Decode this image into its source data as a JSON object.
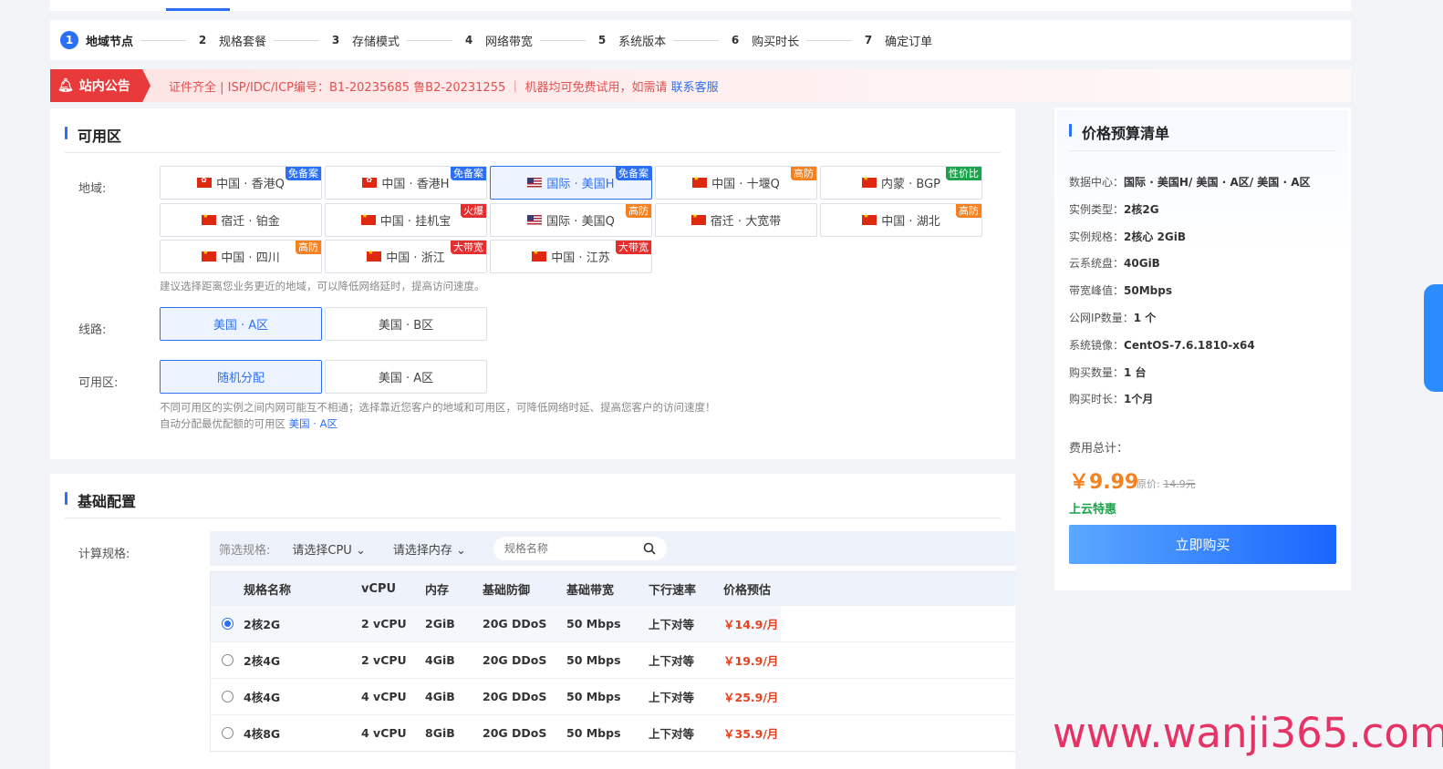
{
  "steps": [
    {
      "num": "1",
      "label": "地域节点"
    },
    {
      "num": "2",
      "label": "规格套餐"
    },
    {
      "num": "3",
      "label": "存储模式"
    },
    {
      "num": "4",
      "label": "网络带宽"
    },
    {
      "num": "5",
      "label": "系统版本"
    },
    {
      "num": "6",
      "label": "购买时长"
    },
    {
      "num": "7",
      "label": "确定订单"
    }
  ],
  "notice": {
    "tag": "站内公告",
    "text": "证件齐全 | ISP/IDC/ICP编号：B1-20235685 鲁B2-20231255 ｜ 机器均可免费试用，如需请 ",
    "link": "联系客服"
  },
  "availability": {
    "title": "可用区",
    "region_label": "地域:",
    "regions": [
      {
        "name": "中国 · 香港Q",
        "flag": "hk",
        "badge": "免备案",
        "badge_color": "blue"
      },
      {
        "name": "中国 · 香港H",
        "flag": "hk",
        "badge": "免备案",
        "badge_color": "blue"
      },
      {
        "name": "国际 · 美国H",
        "flag": "us",
        "badge": "免备案",
        "badge_color": "blue",
        "selected": true
      },
      {
        "name": "中国 · 十堰Q",
        "flag": "cn",
        "badge": "高防",
        "badge_color": "orange"
      },
      {
        "name": "内蒙 · BGP",
        "flag": "cn",
        "badge": "性价比",
        "badge_color": "green"
      },
      {
        "name": "宿迁 · 铂金",
        "flag": "cn",
        "badge": "",
        "badge_color": ""
      },
      {
        "name": "中国 · 挂机宝",
        "flag": "cn",
        "badge": "火爆",
        "badge_color": "red"
      },
      {
        "name": "国际 · 美国Q",
        "flag": "us",
        "badge": "高防",
        "badge_color": "orange"
      },
      {
        "name": "宿迁 · 大宽带",
        "flag": "cn",
        "badge": "",
        "badge_color": ""
      },
      {
        "name": "中国 · 湖北",
        "flag": "cn",
        "badge": "高防",
        "badge_color": "orange"
      },
      {
        "name": "中国 · 四川",
        "flag": "cn",
        "badge": "高防",
        "badge_color": "orange"
      },
      {
        "name": "中国 · 浙江",
        "flag": "cn",
        "badge": "大带宽",
        "badge_color": "red"
      },
      {
        "name": "中国 · 江苏",
        "flag": "cn",
        "badge": "大带宽",
        "badge_color": "red"
      }
    ],
    "region_hint": "建议选择距离您业务更近的地域，可以降低网络延时，提高访问速度。",
    "line_label": "线路:",
    "lines": [
      {
        "name": "美国 · A区",
        "selected": true
      },
      {
        "name": "美国 · B区",
        "selected": false
      }
    ],
    "zone_label": "可用区:",
    "zones": [
      {
        "name": "随机分配",
        "selected": true
      },
      {
        "name": "美国 · A区",
        "selected": false
      }
    ],
    "zone_hint": "不同可用区的实例之间内网可能互不相通；选择靠近您客户的地域和可用区，可降低网络时延、提高您客户的访问速度！",
    "zone_hint2": "自动分配最优配额的可用区 ",
    "zone_hint2_link": "美国 · A区"
  },
  "base": {
    "title": "基础配置",
    "compute_label": "计算规格:",
    "filter_label": "筛选规格:",
    "cpu_select": "请选择CPU ⌄",
    "mem_select": "请选择内存 ⌄",
    "search_placeholder": "规格名称",
    "columns": [
      "规格名称",
      "vCPU",
      "内存",
      "基础防御",
      "基础带宽",
      "下行速率",
      "价格预估"
    ],
    "rows": [
      {
        "name": "2核2G",
        "vcpu": "2 vCPU",
        "mem": "2GiB",
        "ddos": "20G DDoS",
        "bw": "50 Mbps",
        "speed": "上下对等",
        "price": "￥14.9/月",
        "selected": true
      },
      {
        "name": "2核4G",
        "vcpu": "2 vCPU",
        "mem": "4GiB",
        "ddos": "20G DDoS",
        "bw": "50 Mbps",
        "speed": "上下对等",
        "price": "￥19.9/月",
        "selected": false
      },
      {
        "name": "4核4G",
        "vcpu": "4 vCPU",
        "mem": "4GiB",
        "ddos": "20G DDoS",
        "bw": "50 Mbps",
        "speed": "上下对等",
        "price": "￥25.9/月",
        "selected": false
      },
      {
        "name": "4核8G",
        "vcpu": "4 vCPU",
        "mem": "8GiB",
        "ddos": "20G DDoS",
        "bw": "50 Mbps",
        "speed": "上下对等",
        "price": "￥35.9/月",
        "selected": false
      }
    ]
  },
  "summary": {
    "title": "价格预算清单",
    "items": [
      {
        "label": "数据中心：",
        "value": "国际 · 美国H/ 美国 · A区/ 美国 · A区"
      },
      {
        "label": "实例类型：",
        "value": "2核2G"
      },
      {
        "label": "实例规格：",
        "value": "2核心 2GiB"
      },
      {
        "label": "云系统盘：",
        "value": "40GiB"
      },
      {
        "label": "带宽峰值：",
        "value": "50Mbps"
      },
      {
        "label": "公网IP数量：",
        "value": "1 个"
      },
      {
        "label": "系统镜像：",
        "value": "CentOS-7.6.1810-x64"
      },
      {
        "label": "购买数量：",
        "value": "1 台"
      },
      {
        "label": "购买时长：",
        "value": "1个月"
      }
    ],
    "total_label": "费用总计：",
    "total_price": "￥9.99",
    "orig_label": "原价: ",
    "orig_price": "14.9元",
    "promo": "上云特惠",
    "buy": "立即购买"
  },
  "watermark": "www.wanji365.com",
  "colors": {
    "accent": "#2b6ff5",
    "notice_red": "#e83a3a",
    "price_orange": "#f5811f"
  }
}
